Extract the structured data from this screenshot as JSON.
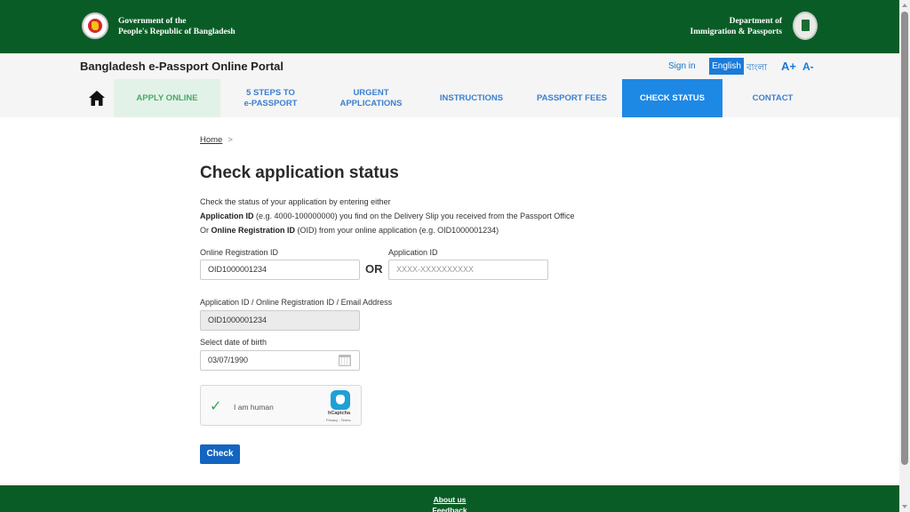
{
  "header": {
    "gov_line1": "Government of the",
    "gov_line2": "People's Republic of Bangladesh",
    "dept_line1": "Department of",
    "dept_line2": "Immigration & Passports"
  },
  "subheader": {
    "portal_title": "Bangladesh e-Passport Online Portal",
    "sign_in": "Sign in",
    "lang_english": "English",
    "lang_bangla": "বাংলা",
    "font_increase": "A+",
    "font_decrease": "A-"
  },
  "nav": {
    "items": [
      {
        "line1": "APPLY ONLINE",
        "line2": ""
      },
      {
        "line1": "5 STEPS TO",
        "line2": "e-PASSPORT"
      },
      {
        "line1": "URGENT",
        "line2": "APPLICATIONS"
      },
      {
        "line1": "INSTRUCTIONS",
        "line2": ""
      },
      {
        "line1": "PASSPORT FEES",
        "line2": ""
      },
      {
        "line1": "CHECK STATUS",
        "line2": ""
      },
      {
        "line1": "CONTACT",
        "line2": ""
      }
    ],
    "active": "CHECK STATUS"
  },
  "breadcrumb": {
    "home": "Home",
    "separator": ">"
  },
  "page": {
    "title": "Check application status",
    "intro_line1": "Check the status of your application by entering either",
    "intro_line2_bold": "Application ID",
    "intro_line2_rest": " (e.g. 4000-100000000) you find on the Delivery Slip you received from the Passport Office",
    "intro_line3_prefix": "Or ",
    "intro_line3_bold": "Online Registration ID",
    "intro_line3_rest": " (OID) from your online application (e.g. OID1000001234)"
  },
  "form": {
    "oid_label": "Online Registration ID",
    "oid_value": "OID1000001234",
    "or_text": "OR",
    "appid_label": "Application ID",
    "appid_placeholder": "XXXX-XXXXXXXXXX",
    "combined_label": "Application ID / Online Registration ID / Email Address",
    "combined_value": "OID1000001234",
    "dob_label": "Select date of birth",
    "dob_value": "03/07/1990",
    "captcha_text": "I am human",
    "captcha_brand": "hCaptcha",
    "captcha_links": "Privacy - Terms",
    "submit_label": "Check"
  },
  "footer": {
    "about": "About us",
    "feedback": "Feedback"
  },
  "colors": {
    "brand_green": "#0a5c26",
    "accent_blue": "#1e88e5",
    "button_blue": "#1565c0"
  }
}
